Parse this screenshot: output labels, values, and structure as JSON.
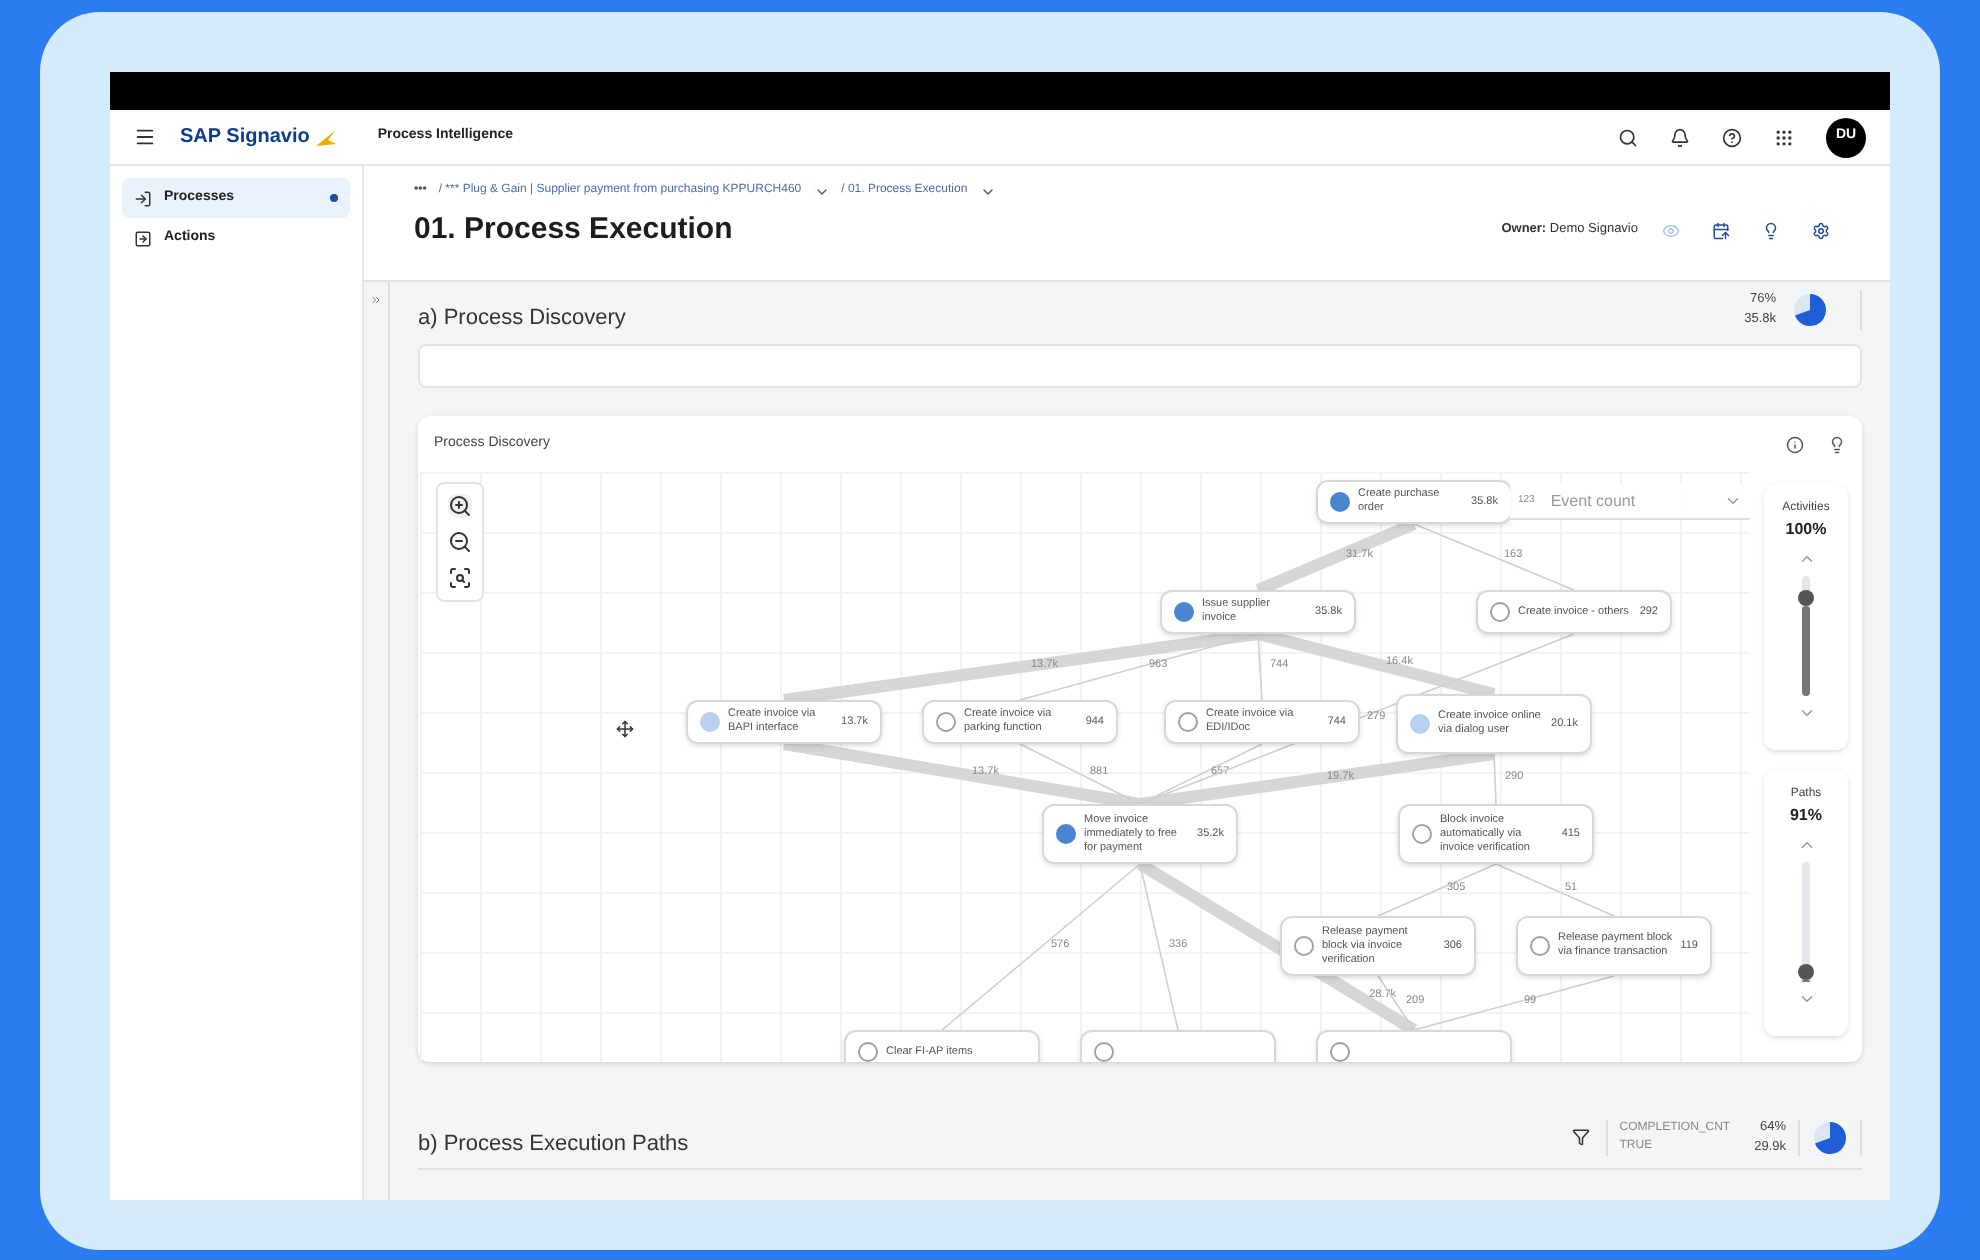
{
  "shell": {
    "brand": "SAP Signavio",
    "product": "Process Intelligence",
    "avatar": "DU"
  },
  "sidebar": {
    "items": [
      {
        "label": "Processes",
        "selected": true,
        "kind": "processes"
      },
      {
        "label": "Actions",
        "selected": false,
        "kind": "actions"
      }
    ]
  },
  "breadcrumb": [
    "•••",
    "/ *** Plug & Gain | Supplier payment from purchasing KPPURCH460",
    "/ 01. Process Execution"
  ],
  "page": {
    "title": "01. Process Execution",
    "owner": "**Owner:** Demo Signavio"
  },
  "section_a": {
    "title": "a) Process Discovery",
    "percent": "76%",
    "count": "35.8k"
  },
  "discovery": {
    "title": "Process Discovery",
    "metric": "Event count",
    "metric_icon": "123",
    "nodes": [
      {
        "label": "Create purchase order",
        "count": "35.8k",
        "kind": "strong"
      },
      {
        "label": "Issue supplier invoice",
        "count": "35.8k",
        "kind": "strong"
      },
      {
        "label": "Create invoice - others",
        "count": "292",
        "kind": "none"
      },
      {
        "label": "Create invoice via BAPI interface",
        "count": "13.7k",
        "kind": "light"
      },
      {
        "label": "Create invoice via parking function",
        "count": "944",
        "kind": "none"
      },
      {
        "label": "Create invoice via EDI/IDoc",
        "count": "744",
        "kind": "none"
      },
      {
        "label": "Create invoice online via dialog user",
        "count": "20.1k",
        "kind": "light"
      },
      {
        "label": "Move invoice immediately to free for payment",
        "count": "35.2k",
        "kind": "strong"
      },
      {
        "label": "Block invoice automatically via invoice verification",
        "count": "415",
        "kind": "none"
      },
      {
        "label": "Release payment block via invoice verification",
        "count": "306",
        "kind": "none"
      },
      {
        "label": "Release payment block via finance transaction",
        "count": "119",
        "kind": "none"
      },
      {
        "label": "Clear FI-AP items",
        "kind": "none"
      },
      {
        "kind": "none"
      },
      {
        "kind": "none"
      }
    ],
    "edges": [
      {
        "label": "31.7k",
        "kind": "thick"
      },
      {
        "label": "163",
        "kind": "thin"
      },
      {
        "label": "13.7k",
        "kind": "thick"
      },
      {
        "label": "963",
        "kind": "thin"
      },
      {
        "label": "744",
        "kind": "thin"
      },
      {
        "label": "16.4k",
        "kind": "thick"
      },
      {
        "label": "13.7k",
        "kind": "thick"
      },
      {
        "label": "881",
        "kind": "thin"
      },
      {
        "label": "657",
        "kind": "thin"
      },
      {
        "label": "19.7k",
        "kind": "thick"
      },
      {
        "label": "279",
        "kind": "thin"
      },
      {
        "label": "290",
        "kind": "thin"
      },
      {
        "label": "576",
        "kind": "thin"
      },
      {
        "label": "336",
        "kind": "thin"
      },
      {
        "label": "28.7k",
        "kind": "thick"
      },
      {
        "label": "305",
        "kind": "thin"
      },
      {
        "label": "51",
        "kind": "thin"
      },
      {
        "label": "209",
        "kind": "thin"
      },
      {
        "label": "99",
        "kind": "thin"
      }
    ],
    "sliders": [
      {
        "title": "Activities",
        "reading": "100%",
        "level": 0.75
      },
      {
        "title": "Paths",
        "reading": "91%",
        "level": 0.02
      }
    ]
  },
  "section_b": {
    "title": "b) Process Execution Paths",
    "filter_name": "COMPLETION_CNT",
    "filter_value": "TRUE",
    "percent": "64%",
    "count": "29.9k"
  }
}
